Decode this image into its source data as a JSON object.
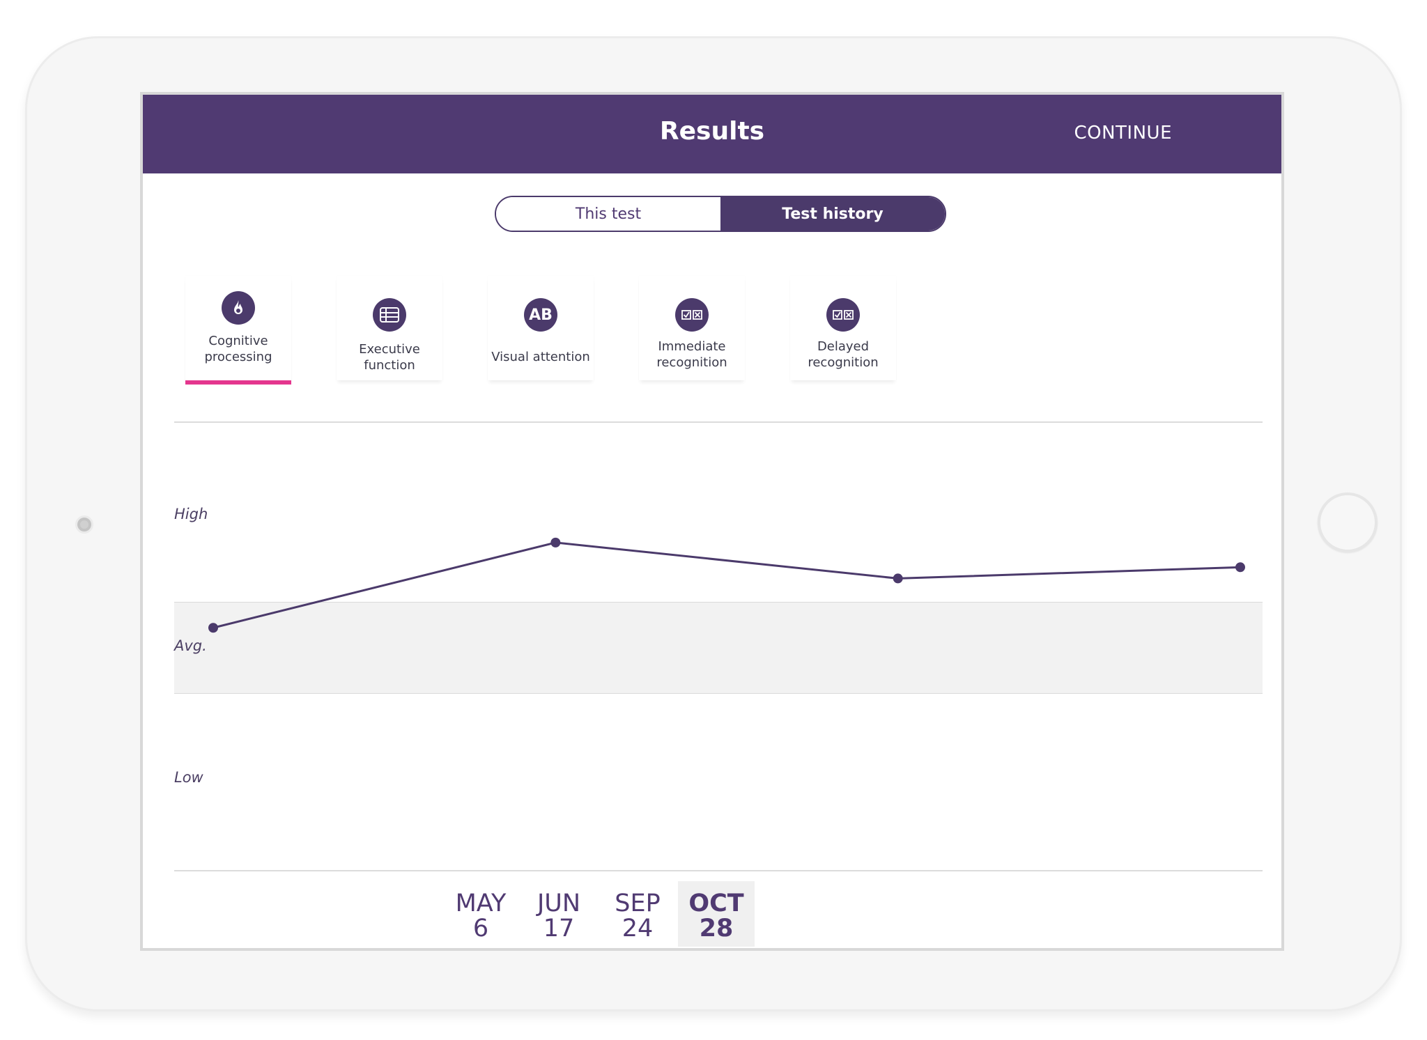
{
  "header": {
    "title": "Results",
    "continue_label": "CONTINUE"
  },
  "segmented": {
    "this_test": "This test",
    "test_history": "Test history",
    "selected": "Test history"
  },
  "domain_tabs": [
    {
      "label_line1": "Cognitive",
      "label_line2": "processing",
      "icon": "fire-icon",
      "selected": true
    },
    {
      "label_line1": "Executive",
      "label_line2": "function",
      "icon": "grid-list-icon",
      "selected": false
    },
    {
      "label_line1": "Visual attention",
      "label_line2": "",
      "icon": "ab-letters-icon",
      "icon_text": "AB",
      "selected": false
    },
    {
      "label_line1": "Immediate",
      "label_line2": "recognition",
      "icon": "check-cross-boxes-icon",
      "selected": false
    },
    {
      "label_line1": "Delayed",
      "label_line2": "recognition",
      "icon": "check-cross-boxes-icon",
      "selected": false
    }
  ],
  "colors": {
    "brand_purple": "#503a72",
    "accent_pink": "#e4368e",
    "avg_band": "#f2f2f2"
  },
  "chart_data": {
    "type": "line",
    "y_labels": [
      "High",
      "Avg.",
      "Low"
    ],
    "x": [
      "MAY 6",
      "JUN 17",
      "SEP 24",
      "OCT 28"
    ],
    "values": [
      0.54,
      0.73,
      0.65,
      0.675
    ],
    "ylim": [
      0,
      1
    ],
    "avg_band": [
      0.41,
      0.56
    ],
    "grid": false
  },
  "dates": [
    {
      "month": "MAY",
      "day": "6",
      "selected": false
    },
    {
      "month": "JUN",
      "day": "17",
      "selected": false
    },
    {
      "month": "SEP",
      "day": "24",
      "selected": false
    },
    {
      "month": "OCT",
      "day": "28",
      "selected": true
    }
  ]
}
